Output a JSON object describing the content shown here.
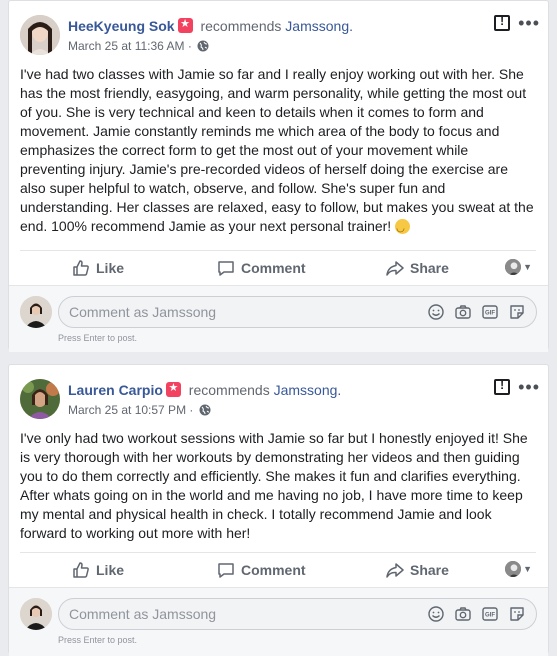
{
  "posts": [
    {
      "author": "HeeKyeung Sok",
      "verb": "recommends",
      "page": "Jamssong.",
      "timestamp": "March 25 at 11:36 AM",
      "separator": "·",
      "text": "I've had two classes with Jamie so far and I really enjoy working out with her. She has the most friendly, easygoing, and warm personality, while getting the most out of you. She is very technical and keen to details when it comes to form and movement. Jamie constantly reminds me which area of the body to focus and emphasizes the correct form to get the most out of your movement while preventing injury. Jamie's pre-recorded videos of herself doing the exercise are also super helpful to watch, observe, and follow. She's super fun and understanding. Her classes are relaxed, easy to follow, but makes you sweat at the end. 100% recommend Jamie as your next personal trainer! ",
      "actions": {
        "like": "Like",
        "comment": "Comment",
        "share": "Share"
      },
      "comment_placeholder": "Comment as Jamssong",
      "comment_hint": "Press Enter to post."
    },
    {
      "author": "Lauren Carpio",
      "verb": "recommends",
      "page": "Jamssong.",
      "timestamp": "March 25 at 10:57 PM",
      "separator": "·",
      "text": "I've only had two workout sessions with Jamie so far but I honestly enjoyed it! She is very thorough with her workouts by demonstrating her videos and then guiding you to do them correctly and efficiently. She makes it fun and clarifies everything. After whats going on in the world and me having no job, I have more time to keep my mental and physical health in check. I totally recommend Jamie and look forward to working out more with her!",
      "actions": {
        "like": "Like",
        "comment": "Comment",
        "share": "Share"
      },
      "comment_placeholder": "Comment as Jamssong",
      "comment_hint": "Press Enter to post."
    }
  ],
  "icons": {
    "recommend_badge": "star-icon",
    "report": "flag-icon",
    "more": "more-dots-icon",
    "privacy": "globe-icon",
    "like": "thumbs-up-icon",
    "comment": "speech-bubble-icon",
    "share": "share-arrow-icon",
    "emoji": "smiley-icon",
    "camera": "camera-icon",
    "gif": "gif-icon",
    "sticker": "sticker-icon"
  },
  "colors": {
    "link": "#385898",
    "badge": "#f3425f",
    "muted": "#616770",
    "background": "#e9ebee"
  }
}
